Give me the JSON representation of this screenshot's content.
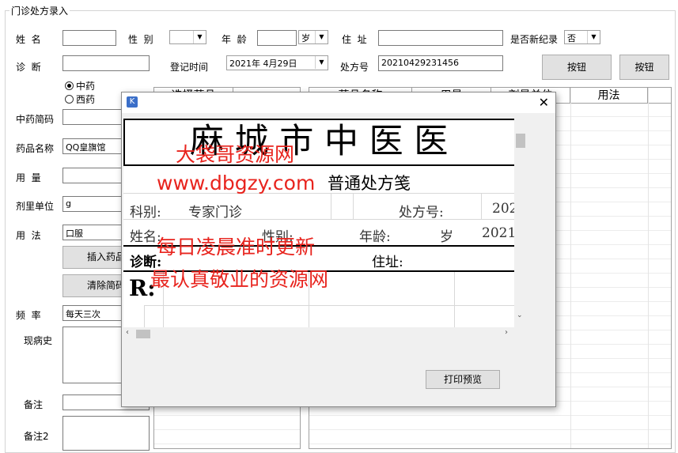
{
  "group_title": "门诊处方录入",
  "form": {
    "name_label": "姓  名",
    "gender_label": "性  别",
    "age_label": "年  龄",
    "age_unit": "岁",
    "address_label": "住  址",
    "new_record_label": "是否新纪录",
    "new_record_value": "否",
    "diagnosis_label": "诊  断",
    "reg_time_label": "登记时间",
    "reg_time_value": "2021年 4月29日",
    "rx_no_label": "处方号",
    "rx_no_value": "20210429231456",
    "button1": "按钮",
    "button2": "按钮",
    "radio_chinese": "中药",
    "radio_western": "西药",
    "herb_code_label": "中药简码",
    "drug_name_label": "药品名称",
    "drug_name_value": "QQ皇旗馆",
    "dosage_label": "用  量",
    "unit_label": "剂里单位",
    "unit_value": "g",
    "usage_label": "用  法",
    "usage_value": "口服",
    "insert_btn": "插入药品",
    "clear_btn": "清除简码",
    "frequency_label": "频  率",
    "frequency_value": "每天三次",
    "history_label": "现病史",
    "note_label": "备注",
    "note2_label": "备注2"
  },
  "grids": {
    "left_header": "选择药品",
    "right_cols": [
      "药品名称",
      "用量",
      "剂量单位",
      "用法"
    ]
  },
  "dialog": {
    "print_btn": "打印预览",
    "hospital_title": "麻 城 市 中 医 医",
    "rx_type": "普通处方笺",
    "dept_label": "科别:",
    "dept_value": "专家门诊",
    "rx_no_label": "处方号:",
    "rx_no_value": "202",
    "name_label": "姓名:",
    "gender_label": "性别:",
    "age_label": "年龄:",
    "age_unit": "岁",
    "date_value": "2021",
    "diagnosis_label": "诊断:",
    "address_label": "住址:",
    "rx_symbol": "R:"
  },
  "watermark": {
    "line1": "大袋哥资源网",
    "line2": "www.dbgzy.com",
    "line3": "每日凌晨准时更新",
    "line4": "最认真敬业的资源网"
  }
}
